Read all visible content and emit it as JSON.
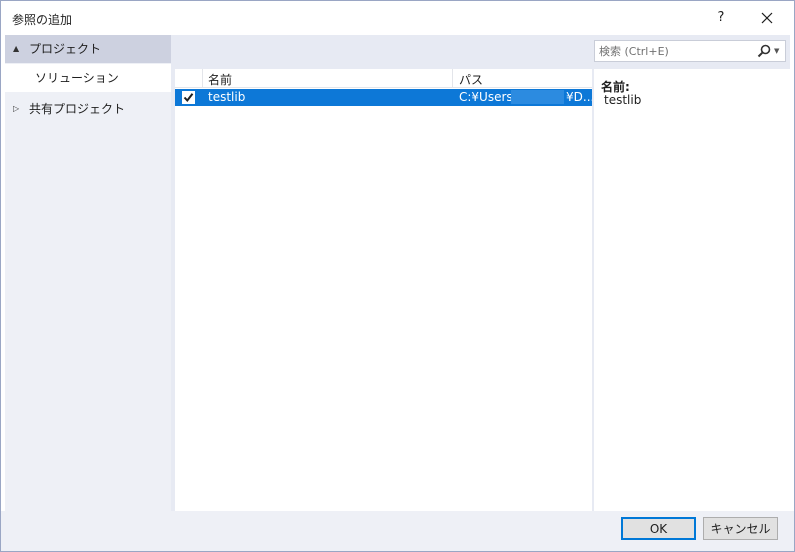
{
  "window": {
    "title": "参照の追加",
    "help": "?"
  },
  "nav": {
    "items": [
      {
        "label": "プロジェクト",
        "arrow": "▲"
      },
      {
        "label": "ソリューション"
      },
      {
        "label": "共有プロジェクト",
        "arrow": "▷"
      }
    ]
  },
  "search": {
    "placeholder": "検索 (Ctrl+E)",
    "dropdown": "▼"
  },
  "list": {
    "columns": [
      "名前",
      "パス"
    ],
    "rows": [
      {
        "checked": true,
        "name": "testlib",
        "path_start": "C:¥Users¥",
        "path_end": "¥D..."
      }
    ]
  },
  "details": {
    "label": "名前:",
    "value": "testlib"
  },
  "footer": {
    "ok": "OK",
    "cancel": "キャンセル"
  },
  "colors": {
    "selection": "#0d78d7",
    "nav_selected": "#cdd1e0",
    "panel": "#e7eaf3"
  }
}
